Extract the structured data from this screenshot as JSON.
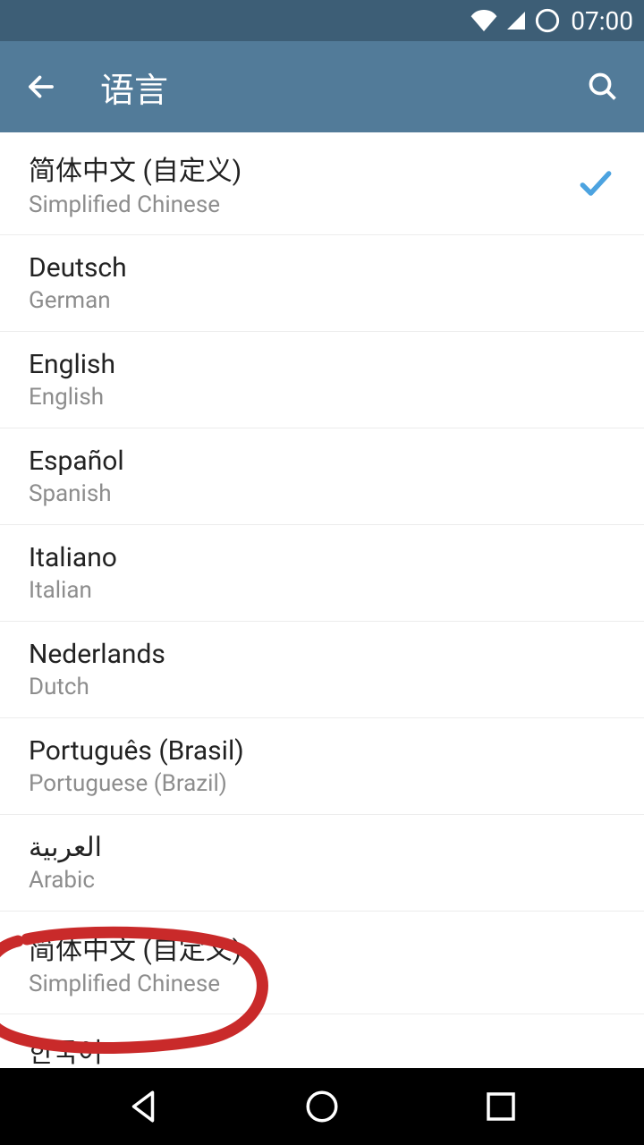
{
  "status": {
    "time": "07:00"
  },
  "header": {
    "title": "语言"
  },
  "languages": [
    {
      "primary": "简体中文 (自定义)",
      "secondary": "Simplified Chinese",
      "selected": true
    },
    {
      "primary": "Deutsch",
      "secondary": "German",
      "selected": false
    },
    {
      "primary": "English",
      "secondary": "English",
      "selected": false
    },
    {
      "primary": "Español",
      "secondary": "Spanish",
      "selected": false
    },
    {
      "primary": "Italiano",
      "secondary": "Italian",
      "selected": false
    },
    {
      "primary": "Nederlands",
      "secondary": "Dutch",
      "selected": false
    },
    {
      "primary": "Português (Brasil)",
      "secondary": "Portuguese (Brazil)",
      "selected": false
    },
    {
      "primary": "العربية",
      "secondary": "Arabic",
      "selected": false
    },
    {
      "primary": "简体中文 (自定义)",
      "secondary": "Simplified Chinese",
      "selected": false
    },
    {
      "primary": "한국어",
      "secondary": "",
      "selected": false
    }
  ],
  "colors": {
    "accent": "#4ca3e0",
    "header_bg": "#527b99",
    "status_bg": "#3d5e76"
  }
}
